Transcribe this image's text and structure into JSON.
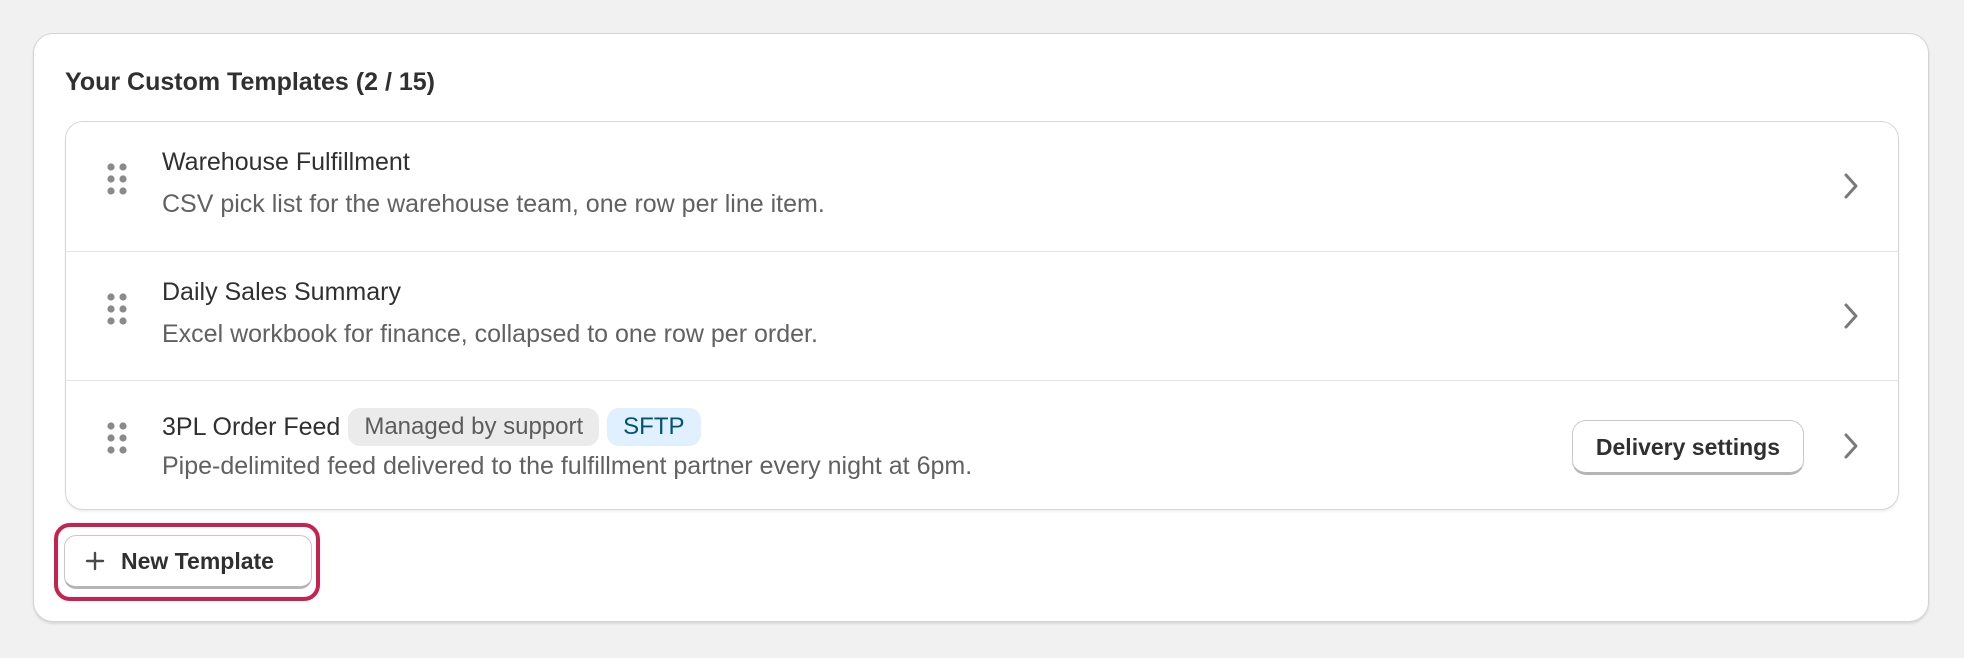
{
  "card": {
    "title": "Your Custom Templates (2 / 15)"
  },
  "templates": [
    {
      "title": "Warehouse Fulfillment",
      "description": "CSV pick list for the warehouse team, one row per line item.",
      "icons": [
        "drag-handle-icon",
        "chevron-right-icon"
      ]
    },
    {
      "title": "Daily Sales Summary",
      "description": "Excel workbook for finance, collapsed to one row per order.",
      "icons": [
        "drag-handle-icon",
        "chevron-right-icon"
      ]
    },
    {
      "title": "3PL Order Feed",
      "badges": [
        "Managed by support",
        "SFTP"
      ],
      "description": "Pipe-delimited feed delivered to the fulfillment partner every night at 6pm.",
      "action_label": "Delivery settings",
      "icons": [
        "drag-handle-icon",
        "chevron-right-icon"
      ]
    }
  ],
  "new_template": {
    "label": "New Template",
    "icon": "plus-icon",
    "focused": true
  },
  "colors": {
    "background": "#f1f1f1",
    "focus_ring": "#c9214f",
    "badge_gray_bg": "#ebebeb",
    "badge_blue_bg": "#e0f0ff",
    "badge_blue_text": "#00527c"
  }
}
